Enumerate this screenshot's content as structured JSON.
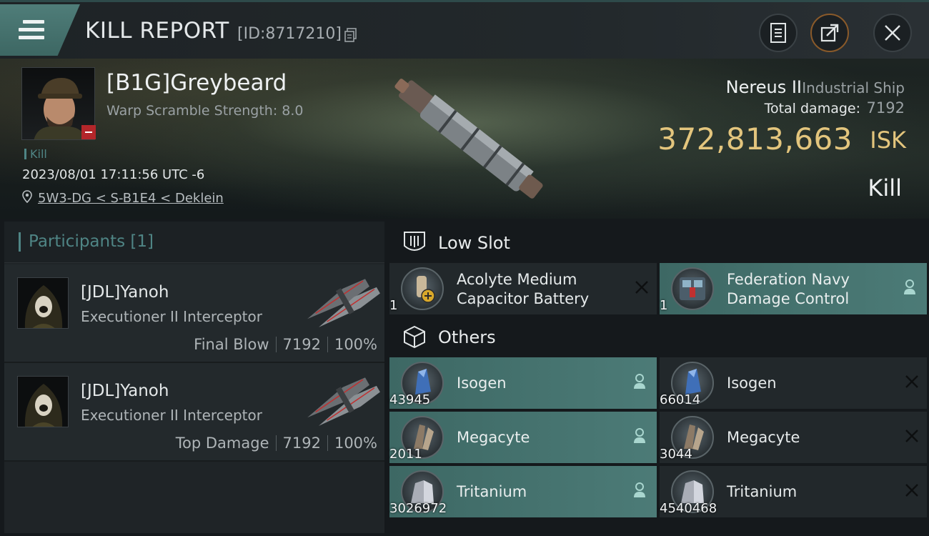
{
  "header": {
    "title": "KILL REPORT",
    "report_id": "[ID:8717210]"
  },
  "victim": {
    "name": "[B1G]Greybeard",
    "warp_scramble": "Warp Scramble Strength: 8.0",
    "kill_tag": "Kill",
    "datetime": "2023/08/01 17:11:56 UTC -6",
    "location": "5W3-DG < S-B1E4 < Deklein",
    "ship_name": "Nereus II",
    "ship_class": "Industrial Ship",
    "total_damage_label": "Total damage:",
    "total_damage": "7192",
    "isk_value": "372,813,663",
    "isk_unit": "ISK",
    "result": "Kill"
  },
  "participants": {
    "header": "Participants [1]",
    "rows": [
      {
        "name": "[JDL]Yanoh",
        "ship": "Executioner II Interceptor",
        "role": "Final Blow",
        "damage": "7192",
        "percent": "100%"
      },
      {
        "name": "[JDL]Yanoh",
        "ship": "Executioner II Interceptor",
        "role": "Top Damage",
        "damage": "7192",
        "percent": "100%"
      }
    ]
  },
  "low_slot": {
    "label": "Low Slot",
    "items": [
      {
        "name_line1": "Acolyte Medium",
        "name_line2": "Capacitor Battery",
        "qty": "1",
        "state": "destroyed"
      },
      {
        "name_line1": "Federation Navy",
        "name_line2": "Damage Control",
        "qty": "1",
        "state": "dropped"
      }
    ]
  },
  "others": {
    "label": "Others",
    "items": [
      {
        "name": "Isogen",
        "qty": "43945",
        "state": "dropped"
      },
      {
        "name": "Isogen",
        "qty": "66014",
        "state": "destroyed"
      },
      {
        "name": "Megacyte",
        "qty": "2011",
        "state": "dropped"
      },
      {
        "name": "Megacyte",
        "qty": "3044",
        "state": "destroyed"
      },
      {
        "name": "Tritanium",
        "qty": "3026972",
        "state": "dropped"
      },
      {
        "name": "Tritanium",
        "qty": "4540468",
        "state": "destroyed"
      }
    ]
  },
  "colors": {
    "accent_teal": "#4f8585",
    "isk_gold": "#e3c57d",
    "dropped_bg": "#4c7b77",
    "panel_bg": "#22282b"
  }
}
